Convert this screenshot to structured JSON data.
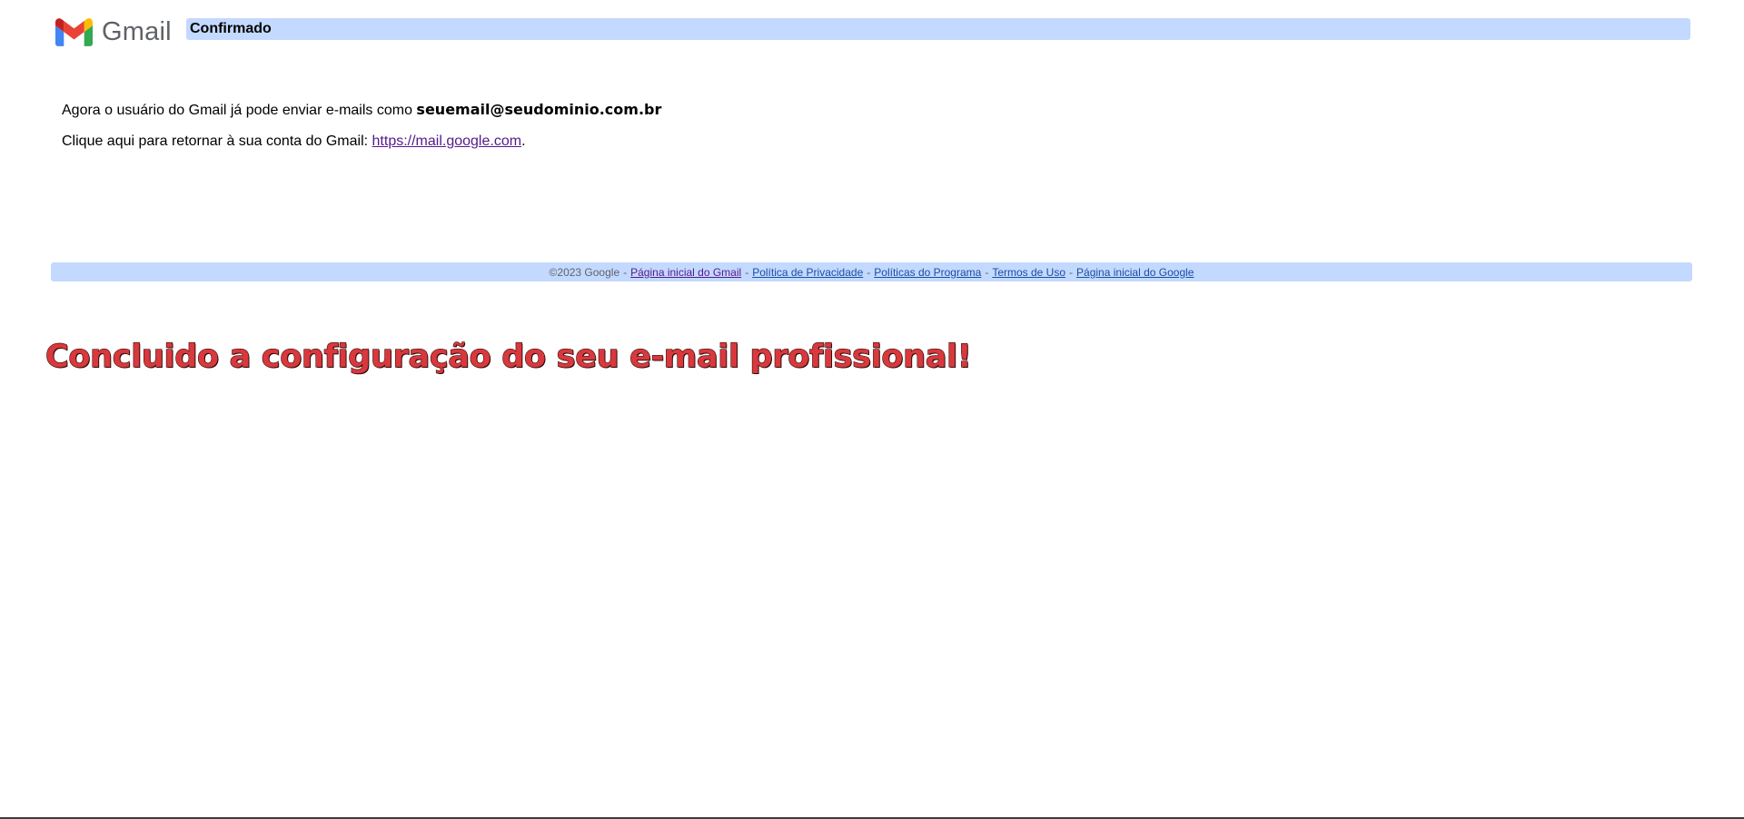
{
  "header": {
    "logo_text": "Gmail",
    "logo_icon": "gmail-m-icon",
    "title": "Confirmado"
  },
  "main": {
    "line1_prefix": "Agora o usuário do Gmail já pode enviar e-mails como ",
    "line1_email": "seuemail@seudominio.com.br",
    "line2_prefix": "Clique aqui para retornar à sua conta do Gmail: ",
    "line2_link": "https://mail.google.com",
    "line2_suffix": "."
  },
  "footer": {
    "copyright": "©2023 Google",
    "sep": "-",
    "links": [
      "Página inicial do Gmail",
      "Política de Privacidade",
      "Políticas do Programa",
      "Termos de Uso",
      "Página inicial do Google"
    ]
  },
  "caption": "Concluido a configuração do seu e-mail profissional!",
  "colors": {
    "bar_blue": "#c3d9ff",
    "link_visited": "#551a8b",
    "link_unvisited": "#1a4fa0",
    "caption_red": "#d9383c",
    "logo_gray": "#5f6368"
  }
}
